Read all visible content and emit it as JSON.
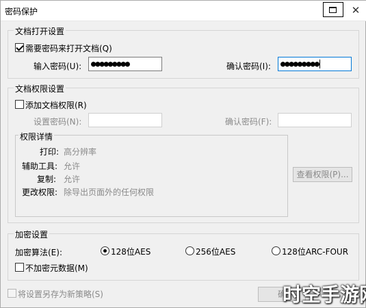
{
  "window": {
    "title": "密码保护",
    "close_glyph": "✕",
    "restore_glyph": "↗"
  },
  "open_settings": {
    "title": "文档打开设置",
    "require_password": {
      "label": "需要密码来打开文档(Q)",
      "checked": true
    },
    "password_label": "输入密码(U):",
    "password_value": "●●●●●●●●●",
    "confirm_label": "确认密码(I):",
    "confirm_value": "●●●●●●●●●"
  },
  "permission_settings": {
    "title": "文档权限设置",
    "add_permission": {
      "label": "添加文档权限(R)",
      "checked": false
    },
    "set_password_label": "设置密码(N):",
    "set_password_value": "",
    "confirm_label": "确认密码(F):",
    "confirm_value": "",
    "details": {
      "title": "权限详情",
      "rows": [
        {
          "key": "打印:",
          "value": "高分辨率"
        },
        {
          "key": "辅助工具:",
          "value": "允许"
        },
        {
          "key": "复制:",
          "value": "允许"
        },
        {
          "key": "更改权限:",
          "value": "除导出页面外的任何权限"
        }
      ]
    },
    "view_permission_button": "查看权限(P)..."
  },
  "encryption": {
    "title": "加密设置",
    "algorithm_label": "加密算法(E):",
    "options": [
      {
        "label": "128位AES",
        "selected": true
      },
      {
        "label": "256位AES",
        "selected": false
      },
      {
        "label": "128位ARC-FOUR",
        "selected": false
      }
    ],
    "no_metadata": {
      "label": "不加密元数据(M)",
      "checked": false
    }
  },
  "footer": {
    "save_policy": {
      "label": "将设置另存为新策略(S)",
      "checked": false
    },
    "ok_button": "确"
  },
  "watermark": "时空手游网"
}
